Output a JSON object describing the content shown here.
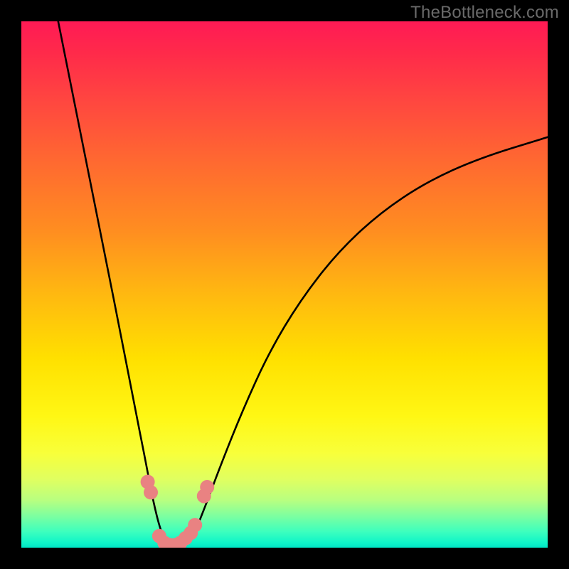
{
  "attribution": "TheBottleneck.com",
  "chart_data": {
    "type": "line",
    "title": "",
    "xlabel": "",
    "ylabel": "",
    "xlim": [
      0,
      100
    ],
    "ylim": [
      0,
      100
    ],
    "series": [
      {
        "name": "bottleneck-curve",
        "x": [
          7,
          10,
          13,
          16,
          19,
          21.5,
          23.5,
          25,
          26.5,
          28,
          29.5,
          31,
          33,
          35,
          38,
          42,
          47,
          53,
          60,
          68,
          77,
          87,
          100
        ],
        "y": [
          100,
          85,
          70,
          55,
          40,
          27,
          17,
          9,
          3,
          0,
          0,
          1,
          3,
          8,
          16,
          26,
          37,
          47,
          56,
          63.5,
          69.5,
          74,
          78
        ]
      }
    ],
    "markers": {
      "name": "highlight-points",
      "color": "#e98282",
      "points": [
        {
          "x": 24.0,
          "y": 12.5
        },
        {
          "x": 24.6,
          "y": 10.5
        },
        {
          "x": 26.2,
          "y": 2.2
        },
        {
          "x": 27.2,
          "y": 0.9
        },
        {
          "x": 28.2,
          "y": 0.5
        },
        {
          "x": 29.2,
          "y": 0.5
        },
        {
          "x": 30.2,
          "y": 0.9
        },
        {
          "x": 31.2,
          "y": 1.8
        },
        {
          "x": 32.2,
          "y": 2.8
        },
        {
          "x": 33.0,
          "y": 4.3
        },
        {
          "x": 34.7,
          "y": 9.8
        },
        {
          "x": 35.3,
          "y": 11.5
        }
      ]
    },
    "gradient_stops": [
      {
        "pos": 0.0,
        "color": "#ff1a55"
      },
      {
        "pos": 0.5,
        "color": "#ffd400"
      },
      {
        "pos": 0.82,
        "color": "#f8ff3a"
      },
      {
        "pos": 1.0,
        "color": "#00e6c6"
      }
    ]
  }
}
